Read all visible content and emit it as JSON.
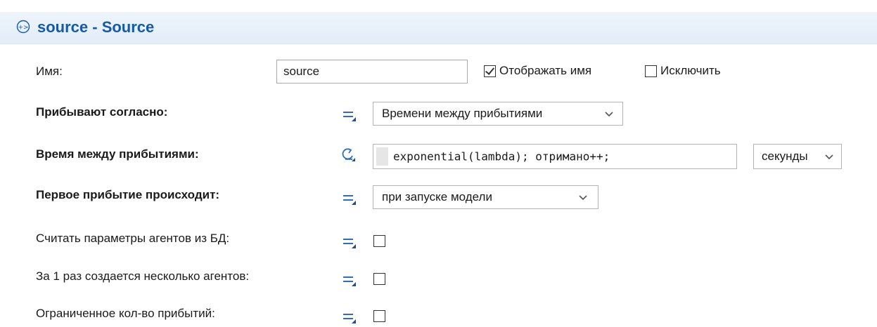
{
  "header": {
    "title": "source - Source",
    "icon": "source-block-icon",
    "title_color": "#155aa8"
  },
  "name_row": {
    "label": "Имя:",
    "value": "source",
    "show_name_label": "Отображать имя",
    "show_name_checked": true,
    "exclude_label": "Исключить",
    "exclude_checked": false
  },
  "arrive_row": {
    "label": "Прибывают согласно:",
    "mode_icon": "static-value-icon",
    "value": "Времени между прибытиями"
  },
  "interarrival_row": {
    "label": "Время между прибытиями:",
    "mode_icon": "dynamic-value-icon",
    "code": "exponential(lambda); отримано++;",
    "unit": "секунды"
  },
  "first_arrival_row": {
    "label": "Первое прибытие происходит:",
    "mode_icon": "static-value-icon",
    "value": "при запуске модели"
  },
  "read_db_row": {
    "label": "Считать параметры агентов из БД:",
    "mode_icon": "static-value-icon",
    "checked": false
  },
  "multiple_row": {
    "label": "За 1 раз создается несколько агентов:",
    "mode_icon": "static-value-icon",
    "checked": false
  },
  "limited_row": {
    "label": "Ограниченное кол-во прибытий:",
    "mode_icon": "static-value-icon",
    "checked": false
  },
  "colors": {
    "accent": "#155aa8",
    "mode_icon": "#2c6fc0"
  }
}
